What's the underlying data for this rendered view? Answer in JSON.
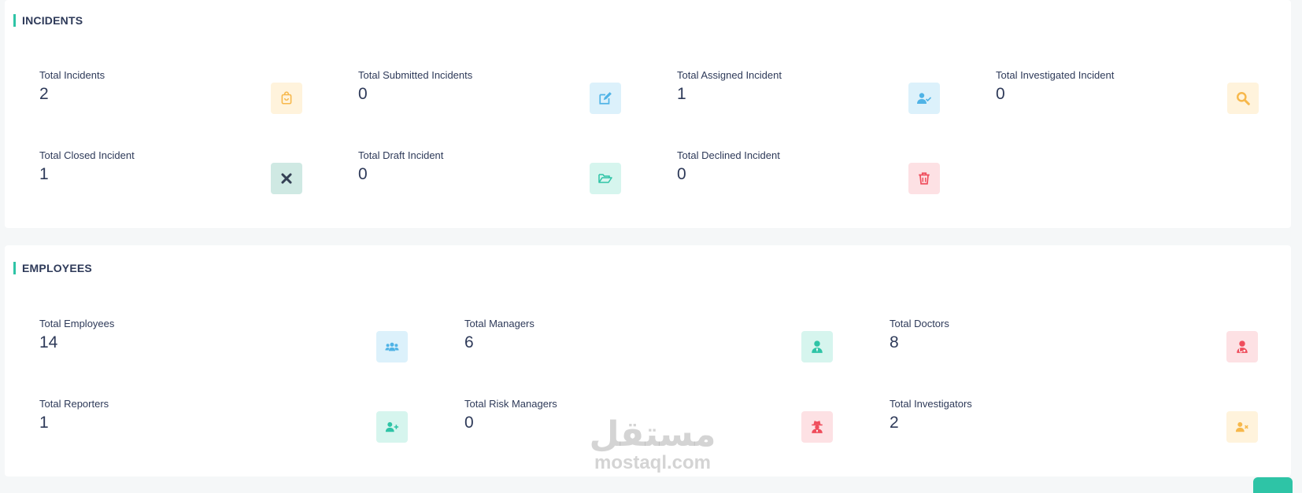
{
  "incidents": {
    "title": "INCIDENTS",
    "stats": [
      {
        "label": "Total Incidents",
        "value": "2",
        "icon": "bag-icon",
        "color": "#f7b84b"
      },
      {
        "label": "Total Submitted Incidents",
        "value": "0",
        "icon": "edit-icon",
        "color": "#4fb3e6"
      },
      {
        "label": "Total Assigned Incident",
        "value": "1",
        "icon": "user-check-icon",
        "color": "#4fb3e6"
      },
      {
        "label": "Total Investigated Incident",
        "value": "0",
        "icon": "search-icon",
        "color": "#f7b84b"
      },
      {
        "label": "Total Closed Incident",
        "value": "1",
        "icon": "close-icon",
        "color": "#344054"
      },
      {
        "label": "Total Draft Incident",
        "value": "0",
        "icon": "folder-open-icon",
        "color": "#2ec4a6"
      },
      {
        "label": "Total Declined Incident",
        "value": "0",
        "icon": "trash-icon",
        "color": "#ef4d5c"
      }
    ]
  },
  "employees": {
    "title": "EMPLOYEES",
    "stats": [
      {
        "label": "Total Employees",
        "value": "14",
        "icon": "users-icon",
        "color": "#4fb3e6"
      },
      {
        "label": "Total Managers",
        "value": "6",
        "icon": "user-tie-icon",
        "color": "#2ec4a6"
      },
      {
        "label": "Total Doctors",
        "value": "8",
        "icon": "user-doctor-icon",
        "color": "#ef4d5c"
      },
      {
        "label": "Total Reporters",
        "value": "1",
        "icon": "user-plus-icon",
        "color": "#2ec4a6"
      },
      {
        "label": "Total Risk Managers",
        "value": "0",
        "icon": "user-secret-icon",
        "color": "#ef4d5c"
      },
      {
        "label": "Total Investigators",
        "value": "2",
        "icon": "user-times-icon",
        "color": "#f7b84b"
      }
    ]
  },
  "watermark": {
    "arabic": "مستقل",
    "latin": "mostaql.com"
  }
}
